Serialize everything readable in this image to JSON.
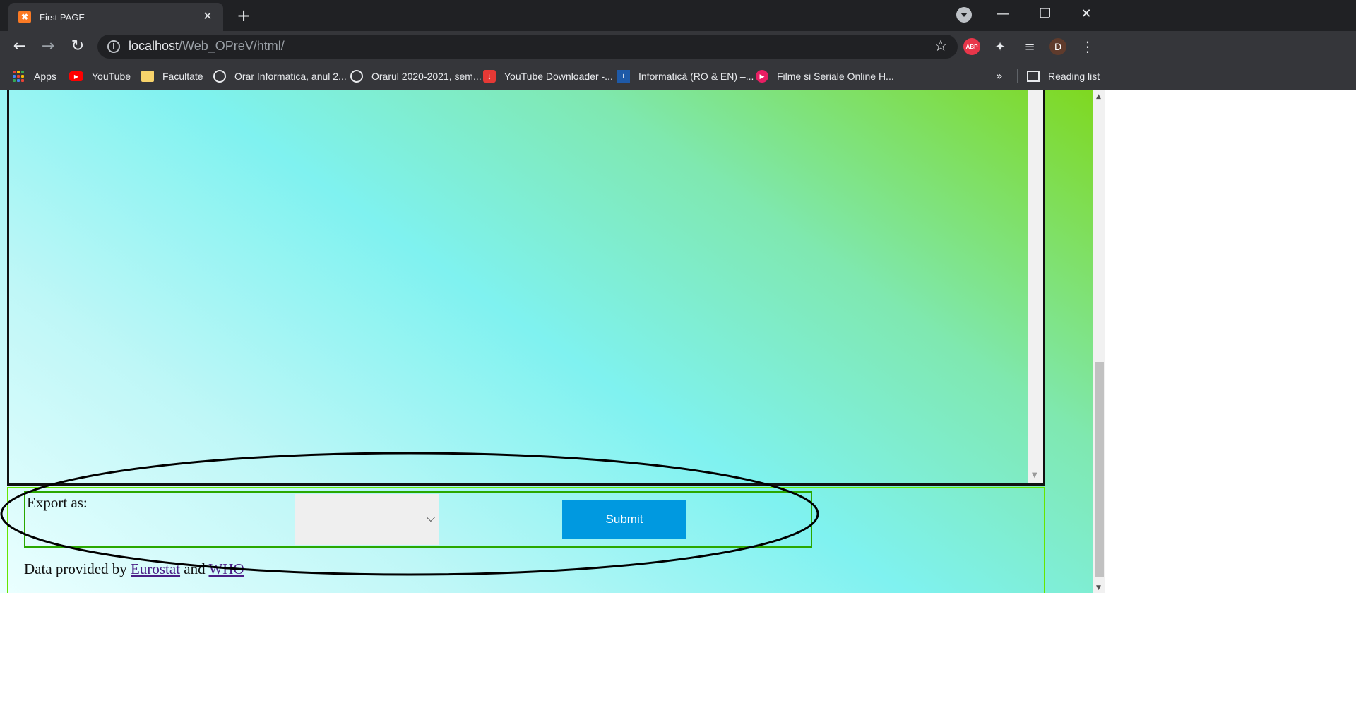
{
  "browser": {
    "tab": {
      "title": "First PAGE",
      "favicon": "xampp-icon"
    },
    "address": {
      "host": "localhost",
      "path": "/Web_OPreV/html/"
    },
    "bookmarks": [
      {
        "label": "Apps",
        "icon": "apps-grid-icon"
      },
      {
        "label": "YouTube",
        "icon": "youtube-icon"
      },
      {
        "label": "Facultate",
        "icon": "folder-icon"
      },
      {
        "label": "Orar Informatica, anul 2...",
        "icon": "globe-icon"
      },
      {
        "label": "Orarul 2020-2021, sem...",
        "icon": "globe-icon"
      },
      {
        "label": "YouTube Downloader -...",
        "icon": "download-icon"
      },
      {
        "label": "Informatică (RO & EN) –...",
        "icon": "info-site-icon"
      },
      {
        "label": "Filme si Seriale Online H...",
        "icon": "play-icon"
      }
    ],
    "bookmarks_overflow": "»",
    "reading_list": "Reading list",
    "profile_initial": "D",
    "extension_abp": "ABP"
  },
  "page": {
    "export_label": "Export as:",
    "export_select_value": "",
    "submit_label": "Submit",
    "credits": {
      "prefix": "Data provided by ",
      "link1": "Eurostat",
      "middle": " and ",
      "link2": "WHO"
    }
  },
  "colors": {
    "chrome_dark": "#202124",
    "chrome_toolbar": "#35363a",
    "submit_bg": "#0099e0",
    "panel_border": "#66e600",
    "export_row_border": "#2aa700",
    "link": "#4b1e86"
  }
}
